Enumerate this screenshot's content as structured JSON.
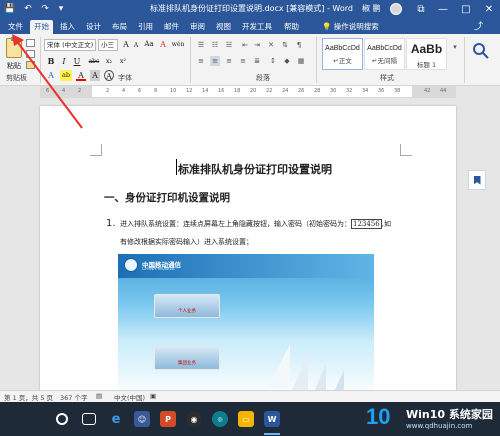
{
  "titlebar": {
    "doc_title": "标准排队机身份证打印设置说明.docx [兼容模式] - Word",
    "user_name": "椒 鹏",
    "save_icon": "💾",
    "undo_icon": "↶",
    "redo_icon": "↷",
    "customize_icon": "▾",
    "restore_icon": "⧉",
    "minimize_icon": "—",
    "maximize_icon": "□",
    "close_icon": "✕"
  },
  "tabs": {
    "items": [
      "文件",
      "开始",
      "插入",
      "设计",
      "布局",
      "引用",
      "邮件",
      "审阅",
      "视图",
      "开发工具",
      "帮助"
    ],
    "active": "开始",
    "tell_me": "操作说明搜索",
    "tell_me_icon": "💡",
    "share_icon": "⤴"
  },
  "ribbon": {
    "clipboard": {
      "paste_label": "粘贴",
      "group_label": "剪贴板"
    },
    "font": {
      "font_name": "宋体 (中文正文)",
      "font_size": "小三",
      "grow": "A",
      "shrink": "A",
      "case": "Aa",
      "clear": "A",
      "phonetic": "wén",
      "bold": "B",
      "italic": "I",
      "underline": "U",
      "strike": "abc",
      "subscript": "x₂",
      "superscript": "x²",
      "text_effect": "A",
      "highlight": "ab",
      "font_color": "A",
      "char_shade": "A",
      "enclose": "A",
      "group_label": "字体"
    },
    "paragraph": {
      "group_label": "段落"
    },
    "styles": {
      "items": [
        {
          "sample": "AaBbCcDd",
          "name": "↵正文"
        },
        {
          "sample": "AaBbCcDd",
          "name": "↵无间隔"
        },
        {
          "sample": "AaBb",
          "name": "标题 1"
        }
      ],
      "group_label": "样式"
    }
  },
  "ruler": {
    "numbers": [
      "6",
      "4",
      "2",
      "2",
      "4",
      "6",
      "8",
      "10",
      "12",
      "14",
      "16",
      "18",
      "20",
      "22",
      "24",
      "26",
      "28",
      "30",
      "32",
      "34",
      "36",
      "38",
      "42",
      "44"
    ]
  },
  "document": {
    "title": "标准排队机身份证打印设置说明",
    "heading": "一、身份证打印机设置说明",
    "list_number": "1.",
    "line1_before": "进入排队系统设置：连续点屏幕左上角隐藏按钮，输入密码（初始密码为：",
    "password": "123456",
    "line1_after": ",如",
    "line2": "有修改根据实际密码输入）进入系统设置；",
    "image": {
      "logo_text": "中国移动通信",
      "logo_sub": "CHINA MOBILE",
      "button1_label": "个人业务",
      "button2_label": "集团业务"
    }
  },
  "statusbar": {
    "page": "第 1 页，共 5 页",
    "words": "367 个字",
    "lang": "中文(中国)"
  },
  "taskbar": {
    "watermark_logo": "10",
    "watermark_text": "Win10 系统家园",
    "watermark_url": "www.qdhuajin.com"
  },
  "colors": {
    "word_blue": "#2b579a",
    "annotation_red": "#e8322b",
    "taskbar": "#1f2a38"
  }
}
